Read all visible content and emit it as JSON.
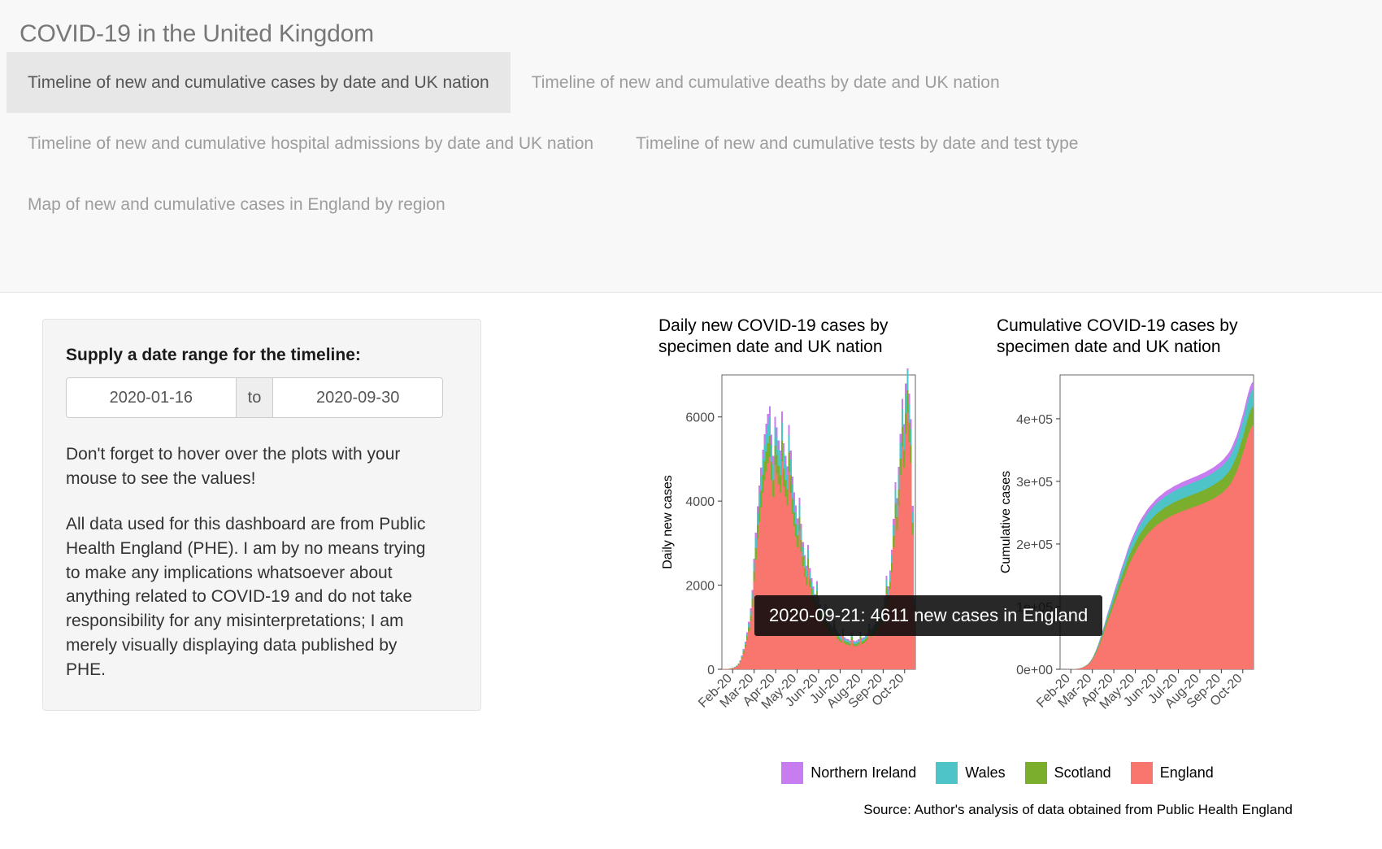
{
  "app": {
    "title": "COVID-19 in the United Kingdom"
  },
  "tabs": [
    {
      "label": "Timeline of new and cumulative cases by date and UK nation",
      "active": true
    },
    {
      "label": "Timeline of new and cumulative deaths by date and UK nation",
      "active": false
    },
    {
      "label": "Timeline of new and cumulative hospital admissions by date and UK nation",
      "active": false
    },
    {
      "label": "Timeline of new and cumulative tests by date and test type",
      "active": false
    },
    {
      "label": "Map of new and cumulative cases in England by region",
      "active": false
    }
  ],
  "sidebar": {
    "date_range_label": "Supply a date range for the timeline:",
    "date_start": "2020-01-16",
    "date_separator": "to",
    "date_end": "2020-09-30",
    "hint_text": "Don't forget to hover over the plots with your mouse to see the values!",
    "disclaimer_text": "All data used for this dashboard are from Public Health England (PHE). I am by no means trying to make any implications whatsoever about anything related to COVID-19 and do not take responsibility for any misinterpretations; I am merely visually displaying data published by PHE."
  },
  "tooltip": {
    "text": "2020-09-21: 4611 new cases in England"
  },
  "legend": {
    "position": "bottom",
    "entries": [
      {
        "label": "Northern Ireland",
        "color": "#C77CF0"
      },
      {
        "label": "Wales",
        "color": "#4EC3C8"
      },
      {
        "label": "Scotland",
        "color": "#7CAE2E"
      },
      {
        "label": "England",
        "color": "#F8766D"
      }
    ]
  },
  "source_note": "Source: Author's analysis of data obtained from Public Health England",
  "chart_data": [
    {
      "type": "bar",
      "stacked": true,
      "title": "Daily new COVID-19 cases by specimen date and UK nation",
      "xlabel": "",
      "ylabel": "Daily new cases",
      "ylim": [
        0,
        7000
      ],
      "yticks": [
        0,
        2000,
        4000,
        6000
      ],
      "ytick_labels": [
        "0",
        "2000",
        "4000",
        "6000"
      ],
      "xticks": [
        "Feb-20",
        "Mar-20",
        "Apr-20",
        "May-20",
        "Jun-20",
        "Jul-20",
        "Aug-20",
        "Sep-20",
        "Oct-20"
      ],
      "grid": false,
      "series": [
        {
          "name": "England",
          "color": "#F8766D",
          "values": [
            5,
            6,
            8,
            10,
            14,
            20,
            30,
            45,
            70,
            110,
            170,
            260,
            380,
            520,
            700,
            900,
            1150,
            1500,
            2100,
            2600,
            3100,
            3500,
            3850,
            4200,
            4500,
            4700,
            4900,
            5050,
            4500,
            4100,
            4850,
            4650,
            4400,
            4200,
            4950,
            4350,
            4100,
            3900,
            4700,
            4200,
            3700,
            3400,
            3150,
            2900,
            3300,
            2800,
            2450,
            2200,
            2000,
            2400,
            1950,
            1750,
            1600,
            1450,
            1700,
            1400,
            1250,
            1150,
            1050,
            1250,
            1000,
            920,
            860,
            800,
            950,
            780,
            720,
            680,
            640,
            780,
            620,
            590,
            580,
            560,
            700,
            560,
            540,
            560,
            580,
            720,
            600,
            620,
            660,
            700,
            880,
            760,
            800,
            860,
            920,
            1150,
            1000,
            1080,
            1200,
            1400,
            1800,
            1600,
            1900,
            2300,
            2900,
            3600,
            3300,
            3900,
            4611,
            5300,
            4800,
            5600,
            6100,
            5400,
            4900,
            3200,
            1400
          ]
        },
        {
          "name": "Scotland",
          "color": "#7CAE2E",
          "values": [
            0,
            0,
            1,
            1,
            2,
            3,
            4,
            6,
            9,
            13,
            20,
            30,
            45,
            60,
            80,
            100,
            130,
            170,
            230,
            280,
            330,
            370,
            400,
            430,
            450,
            470,
            480,
            490,
            440,
            400,
            470,
            450,
            430,
            410,
            480,
            420,
            400,
            380,
            450,
            410,
            360,
            330,
            300,
            280,
            320,
            270,
            240,
            210,
            190,
            230,
            190,
            170,
            150,
            140,
            160,
            130,
            120,
            110,
            100,
            120,
            95,
            88,
            82,
            76,
            90,
            74,
            68,
            64,
            60,
            74,
            58,
            56,
            55,
            53,
            66,
            53,
            51,
            53,
            55,
            68,
            57,
            59,
            63,
            66,
            84,
            72,
            76,
            82,
            88,
            110,
            95,
            103,
            114,
            133,
            171,
            152,
            181,
            219,
            276,
            342,
            314,
            371,
            400,
            460,
            416,
            486,
            529,
            468,
            425,
            277,
            121
          ]
        },
        {
          "name": "Wales",
          "color": "#4EC3C8",
          "values": [
            0,
            0,
            1,
            1,
            1,
            2,
            3,
            5,
            7,
            10,
            16,
            24,
            35,
            48,
            64,
            82,
            105,
            137,
            190,
            235,
            280,
            315,
            345,
            375,
            400,
            420,
            435,
            450,
            400,
            365,
            430,
            410,
            390,
            375,
            440,
            385,
            365,
            345,
            415,
            375,
            330,
            300,
            280,
            255,
            290,
            245,
            215,
            195,
            175,
            210,
            172,
            154,
            141,
            128,
            150,
            123,
            110,
            101,
            92,
            110,
            88,
            81,
            76,
            70,
            84,
            69,
            63,
            60,
            56,
            69,
            55,
            52,
            51,
            49,
            62,
            49,
            48,
            49,
            51,
            63,
            53,
            55,
            58,
            62,
            78,
            67,
            70,
            76,
            81,
            101,
            88,
            95,
            106,
            123,
            158,
            141,
            167,
            203,
            255,
            317,
            290,
            343,
            370,
            425,
            385,
            449,
            489,
            433,
            393,
            257,
            112
          ]
        },
        {
          "name": "Northern Ireland",
          "color": "#C77CF0",
          "values": [
            0,
            0,
            0,
            0,
            1,
            1,
            2,
            3,
            4,
            6,
            9,
            14,
            20,
            28,
            37,
            48,
            61,
            80,
            111,
            137,
            163,
            184,
            202,
            219,
            234,
            245,
            254,
            262,
            234,
            213,
            251,
            240,
            228,
            219,
            257,
            225,
            213,
            201,
            242,
            219,
            193,
            175,
            163,
            149,
            169,
            143,
            126,
            114,
            102,
            122,
            100,
            90,
            82,
            75,
            87,
            72,
            64,
            59,
            54,
            64,
            51,
            47,
            44,
            41,
            49,
            40,
            37,
            35,
            33,
            40,
            32,
            30,
            30,
            29,
            36,
            29,
            28,
            29,
            30,
            37,
            31,
            32,
            34,
            36,
            45,
            39,
            41,
            44,
            47,
            59,
            51,
            55,
            62,
            72,
            92,
            82,
            97,
            118,
            149,
            185,
            169,
            200,
            216,
            248,
            225,
            262,
            285,
            253,
            229,
            150,
            65
          ]
        }
      ]
    },
    {
      "type": "area",
      "stacked": true,
      "title": "Cumulative COVID-19 cases by specimen date and UK nation",
      "xlabel": "",
      "ylabel": "Cumulative cases",
      "ylim": [
        0,
        470000
      ],
      "yticks": [
        0,
        100000,
        200000,
        300000,
        400000
      ],
      "ytick_labels": [
        "0e+00",
        "1e+05",
        "2e+05",
        "3e+05",
        "4e+05"
      ],
      "xticks": [
        "Feb-20",
        "Mar-20",
        "Apr-20",
        "May-20",
        "Jun-20",
        "Jul-20",
        "Aug-20",
        "Sep-20",
        "Oct-20"
      ],
      "grid": false,
      "series": [
        {
          "name": "England",
          "color": "#F8766D",
          "final_value": 390000
        },
        {
          "name": "Scotland",
          "color": "#7CAE2E",
          "final_value": 30000
        },
        {
          "name": "Wales",
          "color": "#4EC3C8",
          "final_value": 28000
        },
        {
          "name": "Northern Ireland",
          "color": "#C77CF0",
          "final_value": 12000
        }
      ]
    }
  ]
}
